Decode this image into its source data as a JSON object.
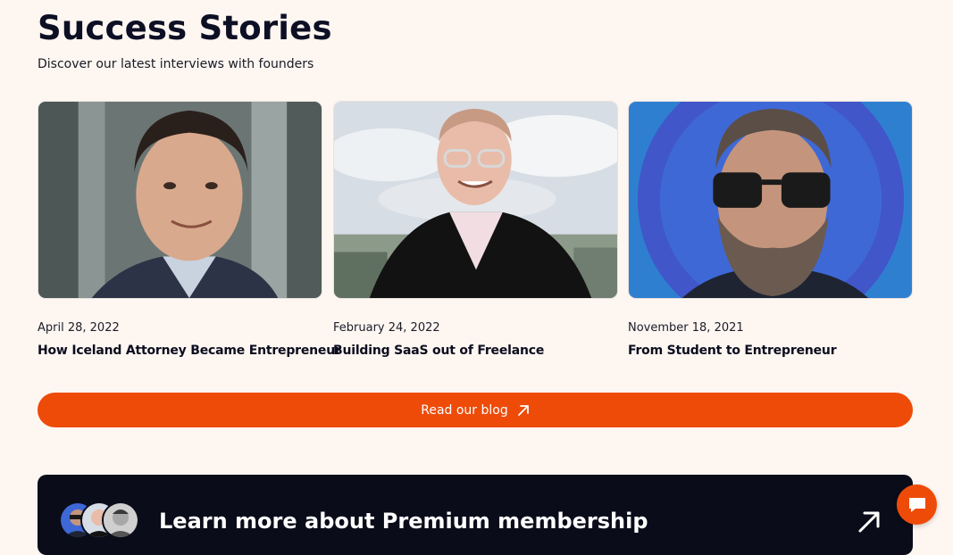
{
  "header": {
    "title": "Success Stories",
    "subtitle": "Discover our latest interviews with founders"
  },
  "stories": [
    {
      "date": "April 28, 2022",
      "title": "How Iceland Attorney Became Entrepreneur",
      "image_icon": "portrait-photo"
    },
    {
      "date": "February 24, 2022",
      "title": "Building SaaS out of Freelance",
      "image_icon": "portrait-photo"
    },
    {
      "date": "November 18, 2021",
      "title": "From Student to Entrepreneur",
      "image_icon": "portrait-photo"
    }
  ],
  "cta": {
    "label": "Read our blog",
    "icon": "arrow-up-right-icon"
  },
  "premium": {
    "title": "Learn more about Premium membership",
    "icon": "arrow-up-right-icon"
  },
  "chat": {
    "icon": "chat-bubble-icon"
  },
  "colors": {
    "accent": "#ee4b09",
    "background": "#fdf6f1",
    "dark": "#0a0c1a",
    "text": "#0b0d1e"
  }
}
